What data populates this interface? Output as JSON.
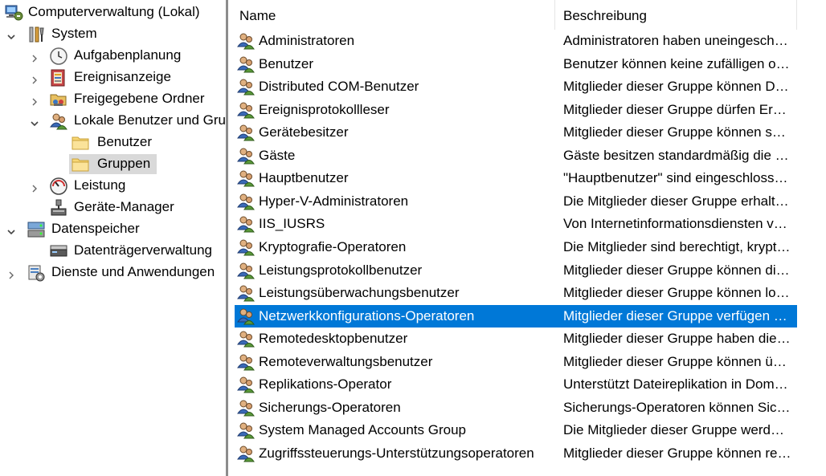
{
  "tree": {
    "root": {
      "label": "Computerverwaltung (Lokal)",
      "icon": "computer-management-icon"
    },
    "items": [
      {
        "label": "System",
        "icon": "tools-icon",
        "expanded": true
      },
      {
        "label": "Aufgabenplanung",
        "icon": "clock-icon",
        "expanded": false
      },
      {
        "label": "Ereignisanzeige",
        "icon": "event-viewer-icon",
        "expanded": false
      },
      {
        "label": "Freigegebene Ordner",
        "icon": "shared-folder-icon",
        "expanded": false
      },
      {
        "label": "Lokale Benutzer und Gruppen",
        "icon": "users-icon",
        "expanded": true
      },
      {
        "label": "Benutzer",
        "icon": "folder-icon"
      },
      {
        "label": "Gruppen",
        "icon": "folder-icon",
        "selected": true
      },
      {
        "label": "Leistung",
        "icon": "performance-icon",
        "expanded": false
      },
      {
        "label": "Geräte-Manager",
        "icon": "device-manager-icon"
      },
      {
        "label": "Datenspeicher",
        "icon": "storage-icon",
        "expanded": true
      },
      {
        "label": "Datenträgerverwaltung",
        "icon": "disk-management-icon"
      },
      {
        "label": "Dienste und Anwendungen",
        "icon": "services-icon",
        "expanded": false
      }
    ]
  },
  "list": {
    "columns": {
      "name": "Name",
      "description": "Beschreibung"
    },
    "rows": [
      {
        "name": "Administratoren",
        "description": "Administratoren haben uneingeschränkten Vollzugriff"
      },
      {
        "name": "Benutzer",
        "description": "Benutzer können keine zufälligen oder beabsichtigten Änderungen"
      },
      {
        "name": "Distributed COM-Benutzer",
        "description": "Mitglieder dieser Gruppe können DCOM-Objekte starten"
      },
      {
        "name": "Ereignisprotokollleser",
        "description": "Mitglieder dieser Gruppe dürfen Ereignisprotokolle lesen"
      },
      {
        "name": "Gerätebesitzer",
        "description": "Mitglieder dieser Gruppe können systemweite Einstellungen ändern"
      },
      {
        "name": "Gäste",
        "description": "Gäste besitzen standardmäßig die gleichen Zugriffsrechte"
      },
      {
        "name": "Hauptbenutzer",
        "description": "\"Hauptbenutzer\" sind eingeschlossen aus Gründen der Abwärtskompatibilität"
      },
      {
        "name": "Hyper-V-Administratoren",
        "description": "Die Mitglieder dieser Gruppe erhalten vollständigen Zugriff"
      },
      {
        "name": "IIS_IUSRS",
        "description": "Von Internetinformationsdiensten verwendete integrierte Gruppe"
      },
      {
        "name": "Kryptografie-Operatoren",
        "description": "Die Mitglieder sind berechtigt, kryptografische Vorgänge durchzuführen"
      },
      {
        "name": "Leistungsprotokollbenutzer",
        "description": "Mitglieder dieser Gruppe können die Protokollierung planen"
      },
      {
        "name": "Leistungsüberwachungsbenutzer",
        "description": "Mitglieder dieser Gruppe können lokal und remote zugreifen"
      },
      {
        "name": "Netzwerkkonfigurations-Operatoren",
        "description": "Mitglieder dieser Gruppe verfügen über einige Administratorrechte",
        "selected": true
      },
      {
        "name": "Remotedesktopbenutzer",
        "description": "Mitglieder dieser Gruppe haben die Berechtigung zur Remoteanmeldung"
      },
      {
        "name": "Remoteverwaltungsbenutzer",
        "description": "Mitglieder dieser Gruppe können über Verwaltungsprotokolle zugreifen"
      },
      {
        "name": "Replikations-Operator",
        "description": "Unterstützt Dateireplikation in Domänen"
      },
      {
        "name": "Sicherungs-Operatoren",
        "description": "Sicherungs-Operatoren können Sicherheitseinschränkungen außer Kraft setzen"
      },
      {
        "name": "System Managed Accounts Group",
        "description": "Die Mitglieder dieser Gruppe werden vom System verwaltet"
      },
      {
        "name": "Zugriffssteuerungs-Unterstützungsoperatoren",
        "description": "Mitglieder dieser Gruppe können remote Autorisierungsattribute abfragen"
      }
    ]
  },
  "colors": {
    "selection": "#0078d7",
    "tree_selection": "#d9d9d9",
    "splitter": "#8c8c8c"
  }
}
